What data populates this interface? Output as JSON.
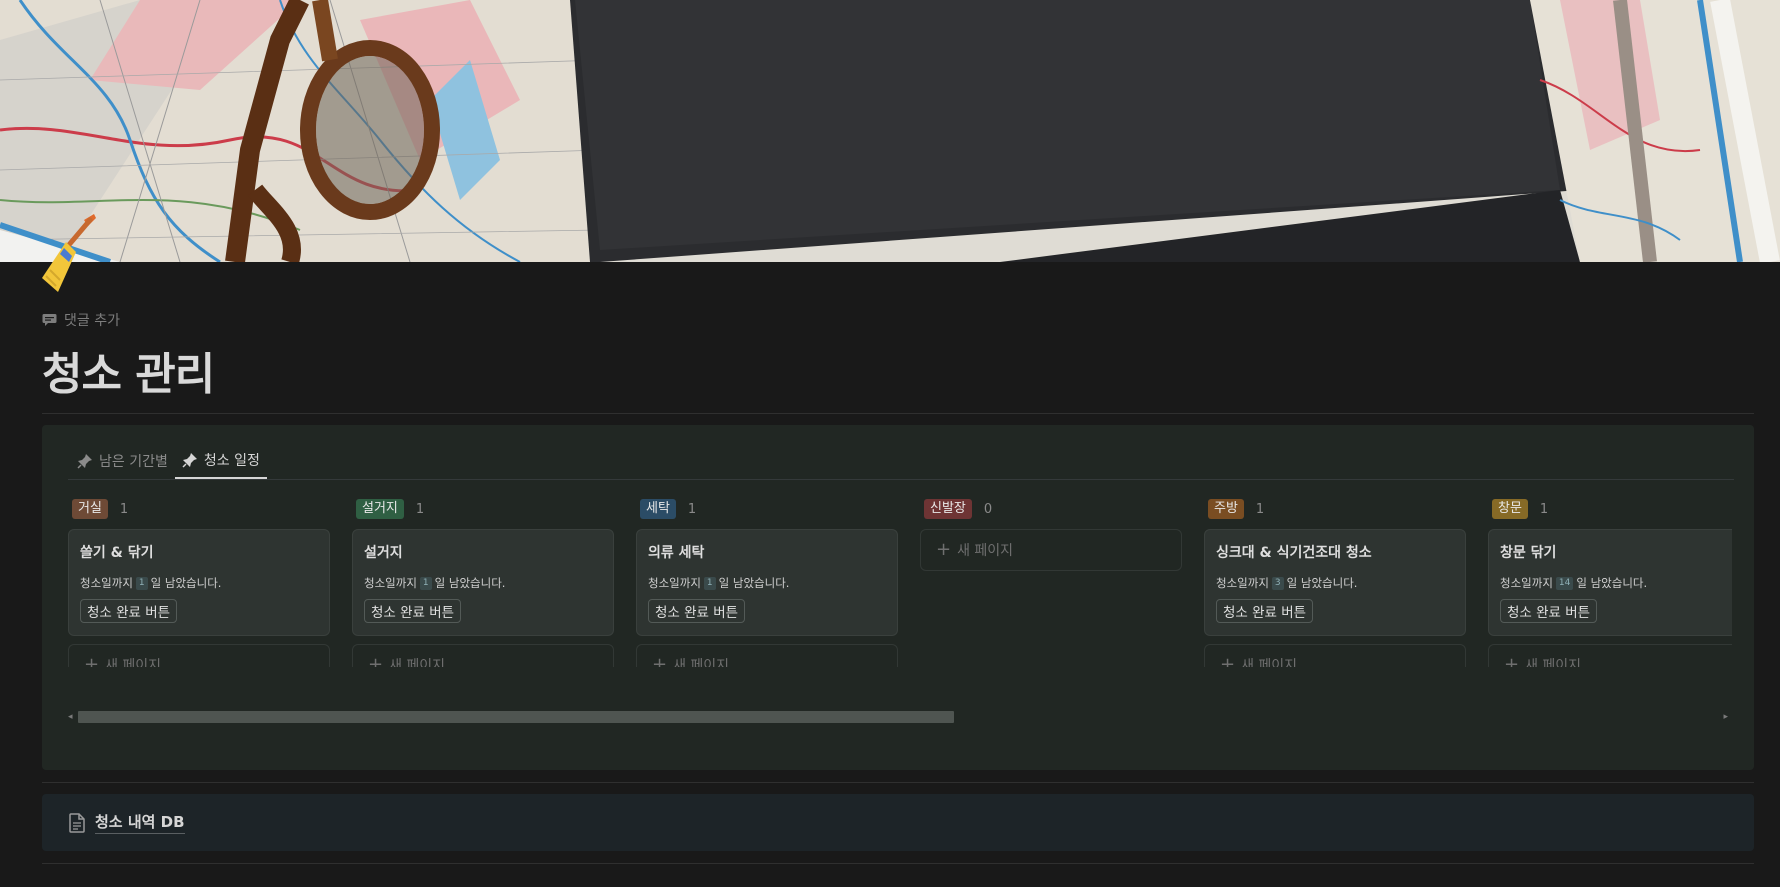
{
  "page": {
    "add_comment": "댓글 추가",
    "title": "청소 관리",
    "icon": "broom-icon"
  },
  "tabs": [
    {
      "label": "남은 기간별",
      "icon": "pin-icon",
      "active": false
    },
    {
      "label": "청소 일정",
      "icon": "pin-icon",
      "active": true
    }
  ],
  "columns": [
    {
      "name": "거실",
      "count": "1",
      "color": "#6e4a36",
      "card": {
        "title": "쓸기 & 닦기",
        "desc_prefix": "청소일까지",
        "days": "1",
        "desc_suffix": "일 남았습니다.",
        "button": "청소 완료 버튼"
      },
      "new_page": "새 페이지"
    },
    {
      "name": "설거지",
      "count": "1",
      "color": "#2f5f43",
      "card": {
        "title": "설거지",
        "desc_prefix": "청소일까지",
        "days": "1",
        "desc_suffix": "일 남았습니다.",
        "button": "청소 완료 버튼"
      },
      "new_page": "새 페이지"
    },
    {
      "name": "세탁",
      "count": "1",
      "color": "#2b4c66",
      "card": {
        "title": "의류 세탁",
        "desc_prefix": "청소일까지",
        "days": "1",
        "desc_suffix": "일 남았습니다.",
        "button": "청소 완료 버튼"
      },
      "new_page": "새 페이지"
    },
    {
      "name": "신발장",
      "count": "0",
      "color": "#6e3434",
      "card": null,
      "new_page": "새 페이지"
    },
    {
      "name": "주방",
      "count": "1",
      "color": "#7a4d22",
      "card": {
        "title": "싱크대 & 식기건조대 청소",
        "desc_prefix": "청소일까지",
        "days": "3",
        "desc_suffix": "일 남았습니다.",
        "button": "청소 완료 버튼"
      },
      "new_page": "새 페이지"
    },
    {
      "name": "창문",
      "count": "1",
      "color": "#876a26",
      "card": {
        "title": "창문 닦기",
        "desc_prefix": "청소일까지",
        "days": "14",
        "desc_suffix": "일 남았습니다.",
        "button": "청소 완료 버튼"
      },
      "new_page": "새 페이지"
    }
  ],
  "linked_db": {
    "label": "청소 내역 DB",
    "icon": "document-icon"
  }
}
